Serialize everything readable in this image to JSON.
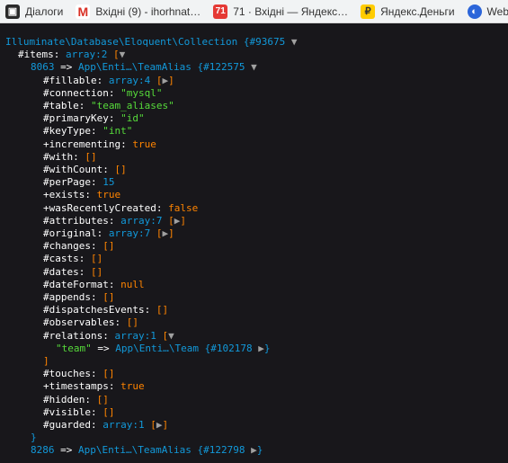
{
  "bookmarks": [
    {
      "label": "Діалоги",
      "icon": "dialogs-icon"
    },
    {
      "label": "Вхідні (9) - ihorhnat…",
      "icon": "gmail-icon"
    },
    {
      "label": "71 · Вхідні — Яндекс…",
      "icon": "yandex-mail-icon"
    },
    {
      "label": "Яндекс.Деньги",
      "icon": "yandex-money-icon"
    },
    {
      "label": "Web",
      "icon": "web-icon"
    }
  ],
  "dump": {
    "class": "Illuminate\\Database\\Eloquent\\Collection",
    "class_id": "{#93675",
    "items_key": "#items",
    "items_type": "array:2",
    "entry1": {
      "index": "8063",
      "class": "App\\Enti…\\TeamAlias",
      "id": "{#122575"
    },
    "props": [
      {
        "key": "#fillable",
        "val": "array:4",
        "type": "collapsed"
      },
      {
        "key": "#connection",
        "val": "\"mysql\"",
        "type": "str"
      },
      {
        "key": "#table",
        "val": "\"team_aliases\"",
        "type": "str"
      },
      {
        "key": "#primaryKey",
        "val": "\"id\"",
        "type": "str"
      },
      {
        "key": "#keyType",
        "val": "\"int\"",
        "type": "str"
      },
      {
        "key": "+incrementing",
        "val": "true",
        "type": "const"
      },
      {
        "key": "#with",
        "val": "[]",
        "type": "pu"
      },
      {
        "key": "#withCount",
        "val": "[]",
        "type": "pu"
      },
      {
        "key": "#perPage",
        "val": "15",
        "type": "num"
      },
      {
        "key": "+exists",
        "val": "true",
        "type": "const"
      },
      {
        "key": "+wasRecentlyCreated",
        "val": "false",
        "type": "const"
      },
      {
        "key": "#attributes",
        "val": "array:7",
        "type": "collapsed"
      },
      {
        "key": "#original",
        "val": "array:7",
        "type": "collapsed"
      },
      {
        "key": "#changes",
        "val": "[]",
        "type": "pu"
      },
      {
        "key": "#casts",
        "val": "[]",
        "type": "pu"
      },
      {
        "key": "#dates",
        "val": "[]",
        "type": "pu"
      },
      {
        "key": "#dateFormat",
        "val": "null",
        "type": "const"
      },
      {
        "key": "#appends",
        "val": "[]",
        "type": "pu"
      },
      {
        "key": "#dispatchesEvents",
        "val": "[]",
        "type": "pu"
      },
      {
        "key": "#observables",
        "val": "[]",
        "type": "pu"
      }
    ],
    "relations": {
      "key": "#relations",
      "type": "array:1",
      "team_key": "\"team\"",
      "team_class": "App\\Enti…\\Team",
      "team_id": "{#102178"
    },
    "props2": [
      {
        "key": "#touches",
        "val": "[]",
        "type": "pu"
      },
      {
        "key": "+timestamps",
        "val": "true",
        "type": "const"
      },
      {
        "key": "#hidden",
        "val": "[]",
        "type": "pu"
      },
      {
        "key": "#visible",
        "val": "[]",
        "type": "pu"
      },
      {
        "key": "#guarded",
        "val": "array:1",
        "type": "collapsed"
      }
    ],
    "entry2": {
      "index": "8286",
      "class": "App\\Enti…\\TeamAlias",
      "id": "{#122798"
    }
  },
  "colors": {
    "background": "#18171b",
    "blue": "#1299da",
    "green": "#56db3a",
    "orange": "#ff8400"
  }
}
